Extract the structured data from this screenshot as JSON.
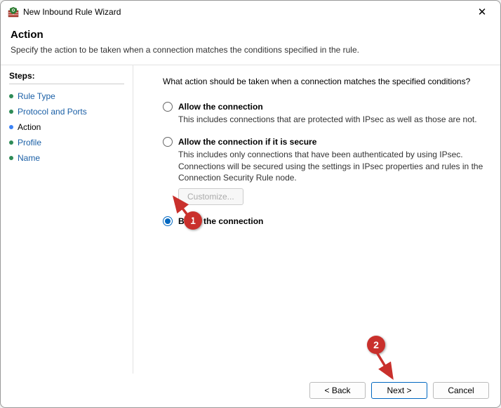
{
  "window": {
    "title": "New Inbound Rule Wizard"
  },
  "header": {
    "title": "Action",
    "description": "Specify the action to be taken when a connection matches the conditions specified in the rule."
  },
  "sidebar": {
    "title": "Steps:",
    "items": [
      {
        "label": "Rule Type",
        "state": "link"
      },
      {
        "label": "Protocol and Ports",
        "state": "link"
      },
      {
        "label": "Action",
        "state": "current"
      },
      {
        "label": "Profile",
        "state": "link"
      },
      {
        "label": "Name",
        "state": "link"
      }
    ]
  },
  "main": {
    "prompt": "What action should be taken when a connection matches the specified conditions?",
    "options": {
      "allow": {
        "label": "Allow the connection",
        "desc": "This includes connections that are protected with IPsec as well as those are not."
      },
      "allow_secure": {
        "label": "Allow the connection if it is secure",
        "desc": "This includes only connections that have been authenticated by using IPsec.  Connections will be secured using the settings in IPsec properties and rules in the Connection Security Rule node.",
        "customize": "Customize..."
      },
      "block": {
        "label": "Block the connection"
      }
    }
  },
  "footer": {
    "back": "< Back",
    "next": "Next >",
    "cancel": "Cancel"
  },
  "annotations": {
    "one": "1",
    "two": "2"
  }
}
